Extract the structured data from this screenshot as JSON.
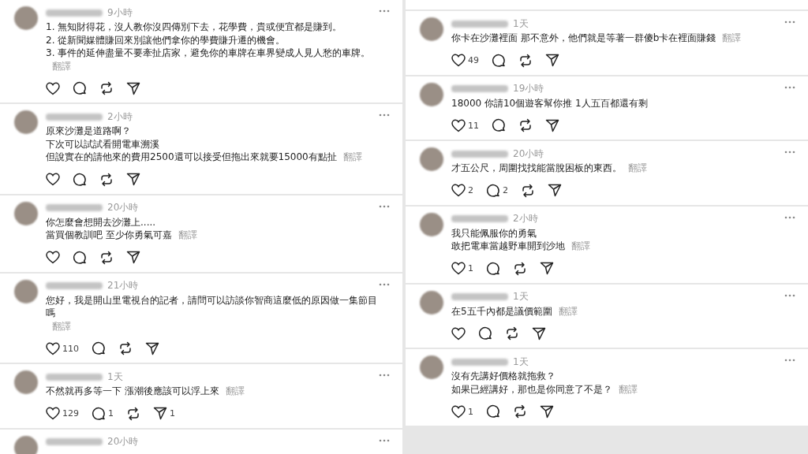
{
  "columns": [
    {
      "posts": [
        {
          "time": "9小時",
          "lines": [
            "1. 無知財得花，沒人教你沒四傳別下去，花學費，貴或便宜都是賺到。",
            "2. 從新聞媒體賺回來別讓他們拿你的學費賺升遷的機會。",
            "3. 事件的延伸盡量不要牽扯店家，避免你的車牌在車界變成人見人愁的車牌。"
          ],
          "translate": "翻譯"
        },
        {
          "time": "2小時",
          "lines": [
            "原來沙灘是道路啊？",
            "下次可以試試看開電車溯溪",
            "但說實在的請他來的費用2500還可以接受但拖出來就要15000有點扯"
          ],
          "translate": "翻譯"
        },
        {
          "time": "20小時",
          "lines": [
            "你怎麼會想開去沙灘上.....",
            "當買個教訓吧 至少你勇氣可嘉"
          ],
          "translate": "翻譯"
        },
        {
          "time": "21小時",
          "lines": [
            "您好，我是開山里電視台的記者，請問可以訪談你智商這麼低的原因做一集節目嗎"
          ],
          "translate": "翻譯",
          "likes": "110"
        },
        {
          "time": "1天",
          "lines": [
            "不然就再多等一下 漲潮後應該可以浮上來"
          ],
          "translate": "翻譯",
          "likes": "129",
          "replies": "1",
          "shares": "1"
        },
        {
          "time": "20小時"
        }
      ]
    },
    {
      "posts": [
        {
          "time": "1天",
          "lines": [
            "你卡在沙灘裡面 那不意外，他們就是等著一群傻b卡在裡面賺錢"
          ],
          "translate": "翻譯",
          "likes": "49"
        },
        {
          "time": "19小時",
          "lines": [
            "18000 你請10個遊客幫你推 1人五百都還有剩"
          ],
          "likes": "11"
        },
        {
          "time": "20小時",
          "lines": [
            "才五公尺，周圍找找能當脫困板的東西。"
          ],
          "translate": "翻譯",
          "likes": "2",
          "replies": "2"
        },
        {
          "time": "2小時",
          "lines": [
            "我只能佩服你的勇氣",
            "敢把電車當越野車開到沙地"
          ],
          "translate": "翻譯",
          "likes": "1"
        },
        {
          "time": "1天",
          "lines": [
            "在5五千內都是議價範圍"
          ],
          "translate": "翻譯"
        },
        {
          "time": "1天",
          "lines": [
            "沒有先講好價格就拖救？",
            "如果已經講好，那也是你同意了不是？"
          ],
          "translate": "翻譯",
          "likes": "1"
        }
      ]
    }
  ]
}
